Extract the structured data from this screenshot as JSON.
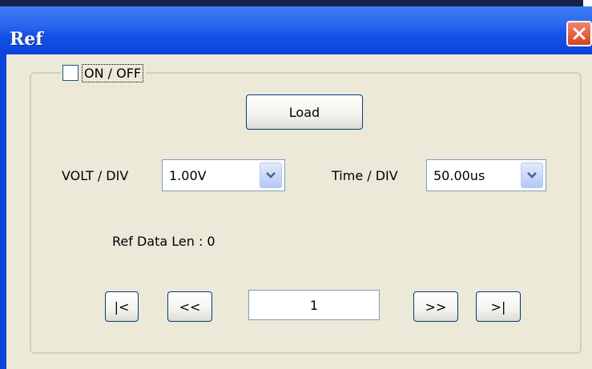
{
  "window": {
    "title": "Ref"
  },
  "toggle": {
    "label": "ON / OFF",
    "checked": false
  },
  "load_button": {
    "label": "Load"
  },
  "volt_div": {
    "label": "VOLT / DIV",
    "value": "1.00V"
  },
  "time_div": {
    "label": "Time / DIV",
    "value": "50.00us"
  },
  "ref_data_len": {
    "text": "Ref Data Len : 0"
  },
  "navigation": {
    "first_label": "|<",
    "prev_label": "<<",
    "page_value": "1",
    "next_label": ">>",
    "last_label": ">|"
  },
  "colors": {
    "titlebar": "#0b45dc",
    "client_bg": "#ece9d8",
    "close_button": "#d8411e"
  }
}
